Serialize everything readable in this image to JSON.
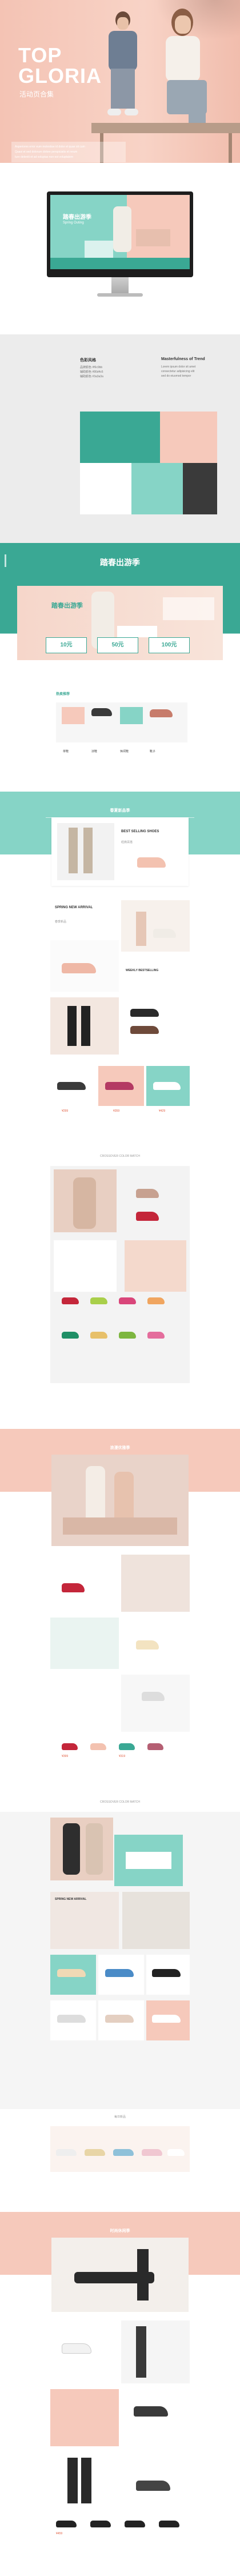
{
  "hero": {
    "title_line1": "TOP",
    "title_line2": "GLORIA",
    "subtitle": "活动页合集",
    "desc1": "Asperiores error eum molestiae id dolor et quae sit cum",
    "desc2": "Quasi et sed dolorum dolore perspiciatis et rerum",
    "desc3": "Iure deleniti et ad voluptas non est voluptatem"
  },
  "monitor": {
    "promo_title": "踏春出游季",
    "promo_sub": "Spring Outing"
  },
  "specs": {
    "left_title": "色彩风格",
    "left_line1": "品牌颜色 #f6c9bb",
    "left_line2": "辅助颜色 #86d4c6",
    "left_line3": "辅助颜色 #3a3a3a",
    "right_title": "Masterfulness of Trend",
    "right_line1": "Lorem ipsum dolor sit amet",
    "right_line2": "consectetur adipisicing elit",
    "right_line3": "sed do eiusmod tempor"
  },
  "palette": {
    "pink": "#f6c9bb",
    "mint": "#86d4c6",
    "teal": "#3aa894",
    "dark": "#3a3a3a"
  },
  "teal_banner": {
    "title": "踏春出游季"
  },
  "promo_banner": {
    "headline": "踏春出游季",
    "coupon1": "10元",
    "coupon2": "50元",
    "coupon3": "100元"
  },
  "filters": {
    "title": "热卖推荐",
    "items": [
      "单鞋",
      "凉鞋",
      "休闲鞋",
      "靴子"
    ]
  },
  "sections": {
    "s1_title": "春夏新品季",
    "s1_card_title": "BEST SELLING SHOES",
    "s1_card_sub": "经典百搭",
    "s1_card_title2": "SPRING NEW ARRIVAL",
    "s1_card_sub2": "春季新品",
    "s1_card_title3": "WEEKLY BESTSELLING",
    "divider1": "CROSSOVER COLOR MATCH",
    "s2_title": "浪漫优雅季",
    "divider2": "CROSSOVER COLOR MATCH",
    "s3_card_title": "SPRING NEW ARRIVAL",
    "divider3": "每日新品",
    "s4_title": "时尚休闲季"
  },
  "prices": [
    "¥299",
    "¥359",
    "¥429",
    "¥399",
    "¥319",
    "¥459"
  ]
}
